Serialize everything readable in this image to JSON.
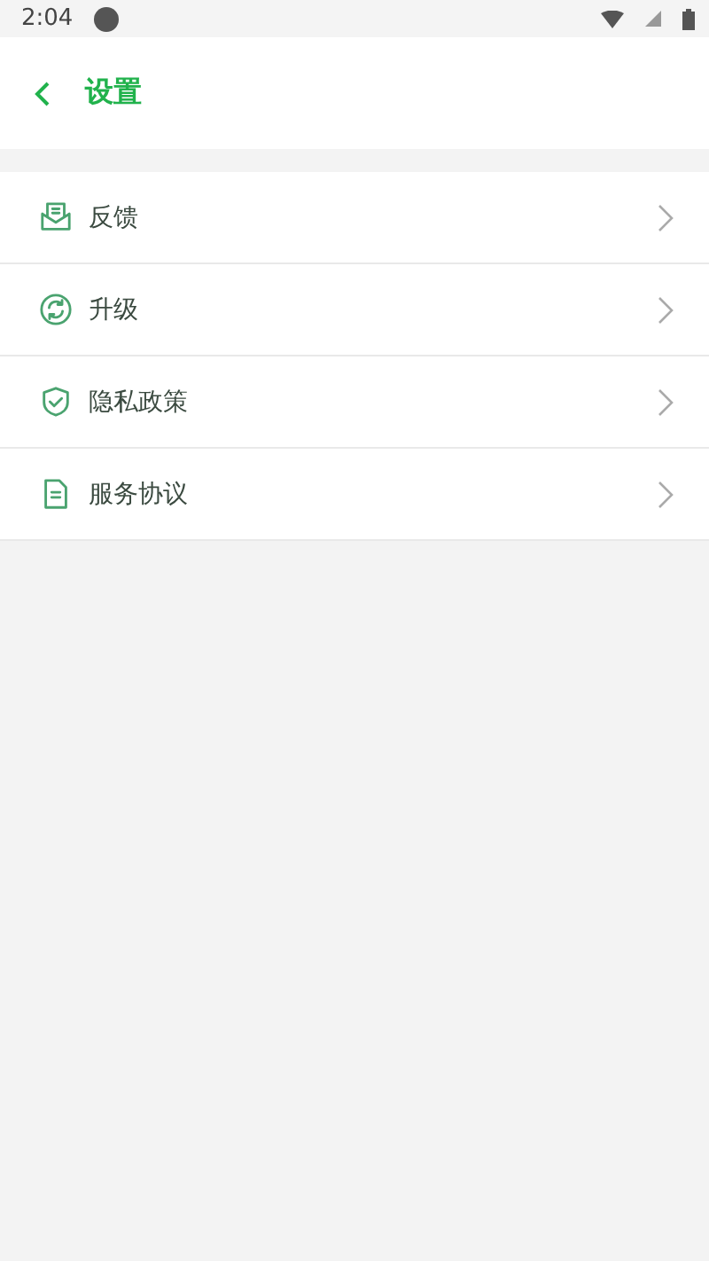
{
  "status_bar": {
    "time": "2:04"
  },
  "header": {
    "title": "设置"
  },
  "menu": [
    {
      "label": "反馈",
      "kind": "feedback"
    },
    {
      "label": "升级",
      "kind": "update"
    },
    {
      "label": "隐私政策",
      "kind": "privacy"
    },
    {
      "label": "服务协议",
      "kind": "agreement"
    }
  ]
}
